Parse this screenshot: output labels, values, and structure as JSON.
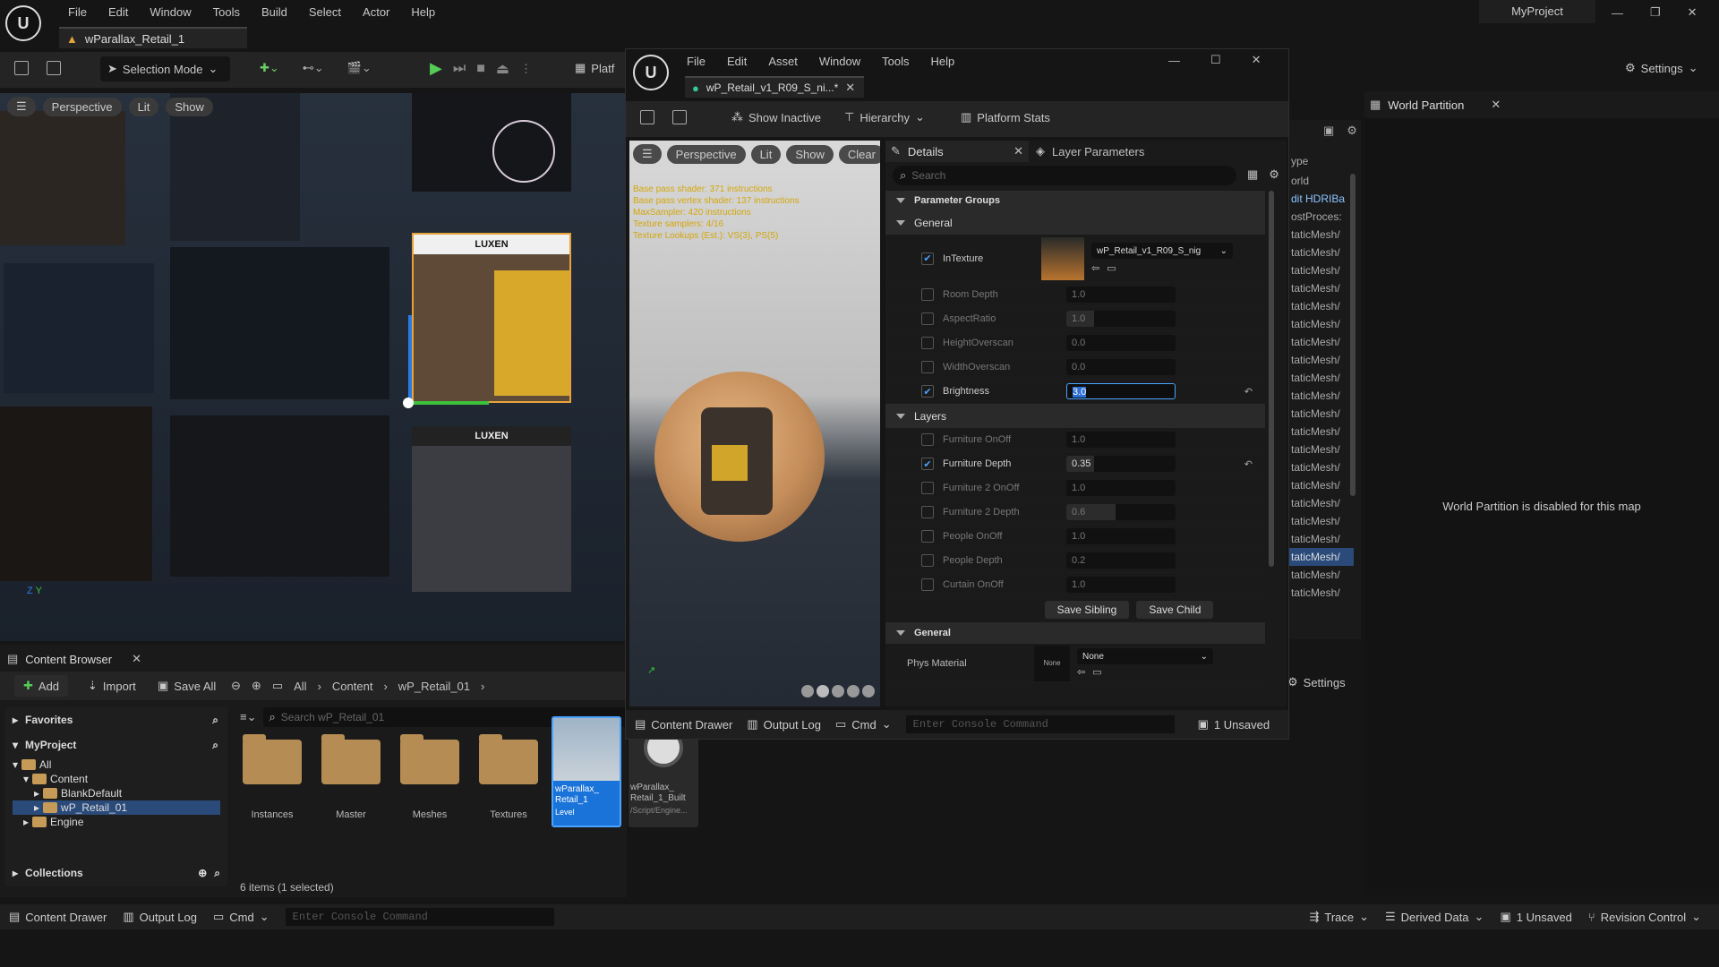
{
  "main": {
    "menu": [
      "File",
      "Edit",
      "Window",
      "Tools",
      "Build",
      "Select",
      "Actor",
      "Help"
    ],
    "project": "MyProject",
    "level_tab": "wParallax_Retail_1",
    "selection_mode": "Selection Mode",
    "platforms": "Platf",
    "settings": "Settings",
    "viewport": {
      "perspective": "Perspective",
      "lit": "Lit",
      "show": "Show",
      "axis_y": "Y",
      "axis_z": "Z"
    },
    "storefronts": [
      "LUXEN",
      "LUXEN"
    ]
  },
  "world_partition": {
    "tab": "World Partition",
    "message": "World Partition is disabled for this map",
    "settings": "Settings"
  },
  "outliner": {
    "header": "ype",
    "items": [
      "orld",
      "dit HDRIBa",
      "ostProces:",
      "taticMesh/",
      "taticMesh/",
      "taticMesh/",
      "taticMesh/",
      "taticMesh/",
      "taticMesh/",
      "taticMesh/",
      "taticMesh/",
      "taticMesh/",
      "taticMesh/",
      "taticMesh/",
      "taticMesh/",
      "taticMesh/",
      "taticMesh/",
      "taticMesh/",
      "taticMesh/",
      "taticMesh/",
      "taticMesh/",
      "taticMesh/",
      "taticMesh/",
      "taticMesh/"
    ],
    "selected_index": 21
  },
  "content_browser": {
    "tab": "Content Browser",
    "add": "Add",
    "import": "Import",
    "save_all": "Save All",
    "path": [
      "All",
      "Content",
      "wP_Retail_01"
    ],
    "favorites": "Favorites",
    "myproject": "MyProject",
    "tree": [
      "All",
      "Content",
      "BlankDefault",
      "wP_Retail_01",
      "Engine"
    ],
    "collections": "Collections",
    "search_placeholder": "Search wP_Retail_01",
    "assets": [
      {
        "name": "Instances"
      },
      {
        "name": "Master"
      },
      {
        "name": "Meshes"
      },
      {
        "name": "Textures"
      }
    ],
    "level_asset": {
      "name": "wParallax_\nRetail_1",
      "type": "Level"
    },
    "built_asset": {
      "name": "wParallax_\nRetail_1_Built",
      "type": "/Script/Engine..."
    },
    "count": "6 items (1 selected)"
  },
  "bottom_bar": {
    "content_drawer": "Content Drawer",
    "output_log": "Output Log",
    "cmd": "Cmd",
    "console_placeholder": "Enter Console Command",
    "trace": "Trace",
    "derived_data": "Derived Data",
    "unsaved": "1 Unsaved",
    "revision_control": "Revision Control"
  },
  "mat_editor": {
    "menu": [
      "File",
      "Edit",
      "Asset",
      "Window",
      "Tools",
      "Help"
    ],
    "tab": "wP_Retail_v1_R09_S_ni...*",
    "toolbar": {
      "show_inactive": "Show Inactive",
      "hierarchy": "Hierarchy",
      "platform_stats": "Platform Stats"
    },
    "viewport": {
      "perspective": "Perspective",
      "lit": "Lit",
      "show": "Show",
      "clear": "Clear",
      "stats": [
        "Base pass shader: 371 instructions",
        "Base pass vertex shader: 137 instructions",
        "MaxSampler: 420 instructions",
        "Texture samplers: 4/16",
        "Texture Lookups (Est.): VS(3), PS(5)"
      ]
    },
    "details_tab": "Details",
    "layer_tab": "Layer Parameters",
    "search_placeholder": "Search",
    "param_groups": "Parameter Groups",
    "general": "General",
    "in_texture": {
      "label": "InTexture",
      "asset": "wP_Retail_v1_R09_S_nig"
    },
    "general_rows": [
      {
        "name": "Room Depth",
        "value": "1.0",
        "on": false,
        "fill": 0
      },
      {
        "name": "AspectRatio",
        "value": "1.0",
        "on": false,
        "fill": 0.25
      },
      {
        "name": "HeightOverscan",
        "value": "0.0",
        "on": false,
        "fill": 0
      },
      {
        "name": "WidthOverscan",
        "value": "0.0",
        "on": false,
        "fill": 0
      },
      {
        "name": "Brightness",
        "value": "3.0",
        "on": true,
        "fill": 0
      }
    ],
    "layers": "Layers",
    "layer_rows": [
      {
        "name": "Furniture OnOff",
        "value": "1.0",
        "on": false,
        "fill": 0
      },
      {
        "name": "Furniture  Depth",
        "value": "0.35",
        "on": true,
        "fill": 0.25
      },
      {
        "name": "Furniture 2 OnOff",
        "value": "1.0",
        "on": false,
        "fill": 0
      },
      {
        "name": "Furniture 2 Depth",
        "value": "0.6",
        "on": false,
        "fill": 0.45
      },
      {
        "name": "People OnOff",
        "value": "1.0",
        "on": false,
        "fill": 0
      },
      {
        "name": "People Depth",
        "value": "0.2",
        "on": false,
        "fill": 0
      },
      {
        "name": "Curtain OnOff",
        "value": "1.0",
        "on": false,
        "fill": 0
      }
    ],
    "save_sibling": "Save Sibling",
    "save_child": "Save Child",
    "general2": "General",
    "phys_material": "Phys Material",
    "phys_value": "None",
    "phys_thumb": "None",
    "bottom": {
      "content_drawer": "Content Drawer",
      "output_log": "Output Log",
      "cmd": "Cmd",
      "console_placeholder": "Enter Console Command",
      "unsaved": "1 Unsaved"
    }
  }
}
